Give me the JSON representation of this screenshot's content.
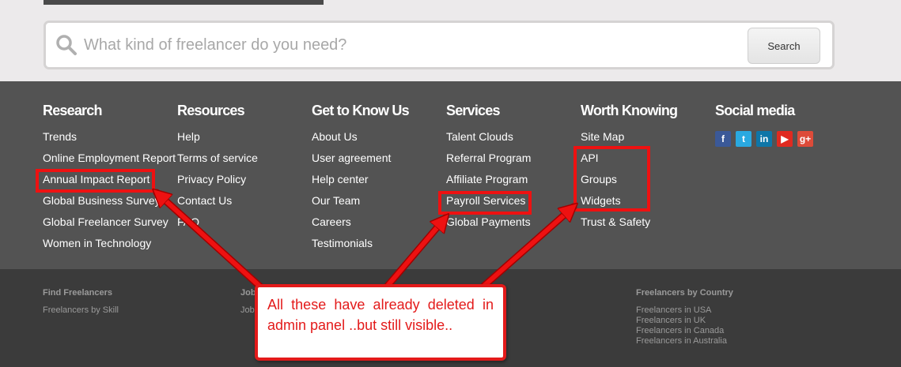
{
  "search": {
    "placeholder": "What kind of freelancer do you need?",
    "button_label": "Search"
  },
  "footer": {
    "columns": [
      {
        "heading": "Research",
        "links": [
          "Trends",
          "Online Employment Report",
          "Annual Impact Report",
          "Global Business Survey",
          "Global Freelancer Survey",
          "Women in Technology"
        ]
      },
      {
        "heading": "Resources",
        "links": [
          "Help",
          "Terms of service",
          "Privacy Policy",
          "Contact Us",
          "FAQ"
        ]
      },
      {
        "heading": "Get to Know Us",
        "links": [
          "About Us",
          "User agreement",
          "Help center",
          "Our Team",
          "Careers",
          "Testimonials"
        ]
      },
      {
        "heading": "Services",
        "links": [
          "Talent Clouds",
          "Referral Program",
          "Affiliate Program",
          "Payroll Services",
          "Global Payments"
        ]
      },
      {
        "heading": "Worth Knowing",
        "links": [
          "Site Map",
          "API",
          "Groups",
          "Widgets",
          "Trust & Safety"
        ]
      },
      {
        "heading": "Social media"
      }
    ],
    "social": [
      {
        "icon": "facebook-icon",
        "glyph": "f",
        "color": "#3b5998"
      },
      {
        "icon": "twitter-icon",
        "glyph": "t",
        "color": "#2aa9e0"
      },
      {
        "icon": "linkedin-icon",
        "glyph": "in",
        "color": "#0e76a8"
      },
      {
        "icon": "youtube-icon",
        "glyph": "▶",
        "color": "#e02a20"
      },
      {
        "icon": "google-plus-icon",
        "glyph": "g+",
        "color": "#dd4b39"
      }
    ]
  },
  "footer_bottom": {
    "find": {
      "heading": "Find Freelancers",
      "links": [
        "Freelancers by Skill"
      ]
    },
    "jobs": {
      "heading": "Job",
      "links": [
        "Job"
      ]
    },
    "country": {
      "heading": "Freelancers by Country",
      "links": [
        "Freelancers in USA",
        "Freelancers in UK",
        "Freelancers in Canada",
        "Freelancers in Australia"
      ]
    }
  },
  "annotation": {
    "text": "All these have already deleted in admin panel ..but still visible..",
    "color": "#e31a1a"
  }
}
